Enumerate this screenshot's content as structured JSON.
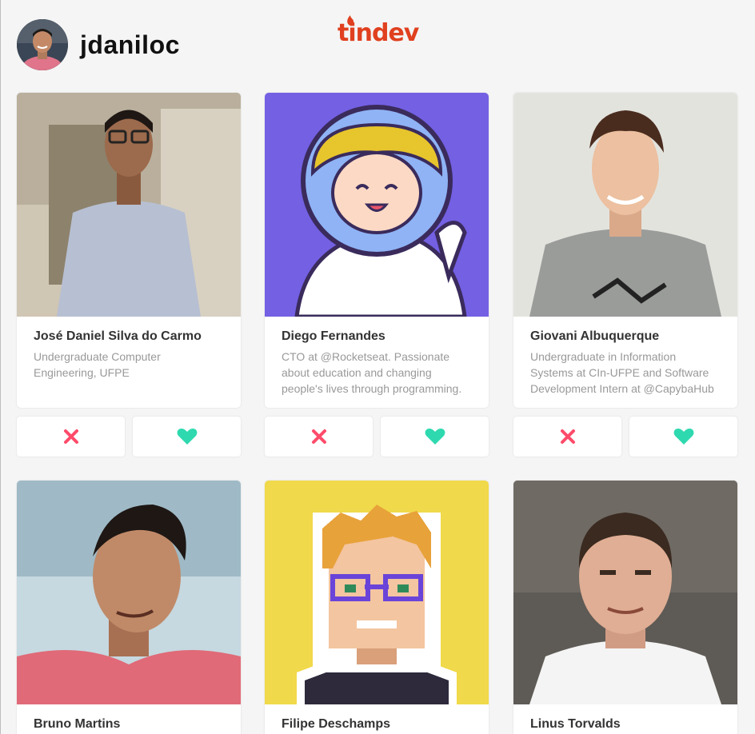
{
  "user": {
    "username": "jdaniloc"
  },
  "brand": {
    "logo_text": "tindev",
    "accent": "#e0401f"
  },
  "colors": {
    "dislike": "#ff4b6a",
    "like": "#2fd9b0"
  },
  "cards": [
    {
      "name": "José Daniel Silva do Carmo",
      "bio": "Undergraduate Computer Engineering, UFPE"
    },
    {
      "name": "Diego Fernandes",
      "bio": "CTO at @Rocketseat. Passionate about education and changing people's lives through programming."
    },
    {
      "name": "Giovani Albuquerque",
      "bio": "Undergraduate in Information Systems at CIn-UFPE and Software Development Intern at @CapybaHub"
    },
    {
      "name": "Bruno Martins",
      "bio": ""
    },
    {
      "name": "Filipe Deschamps",
      "bio": ""
    },
    {
      "name": "Linus Torvalds",
      "bio": ""
    }
  ],
  "icons": {
    "dislike": "close-icon",
    "like": "heart-icon"
  }
}
